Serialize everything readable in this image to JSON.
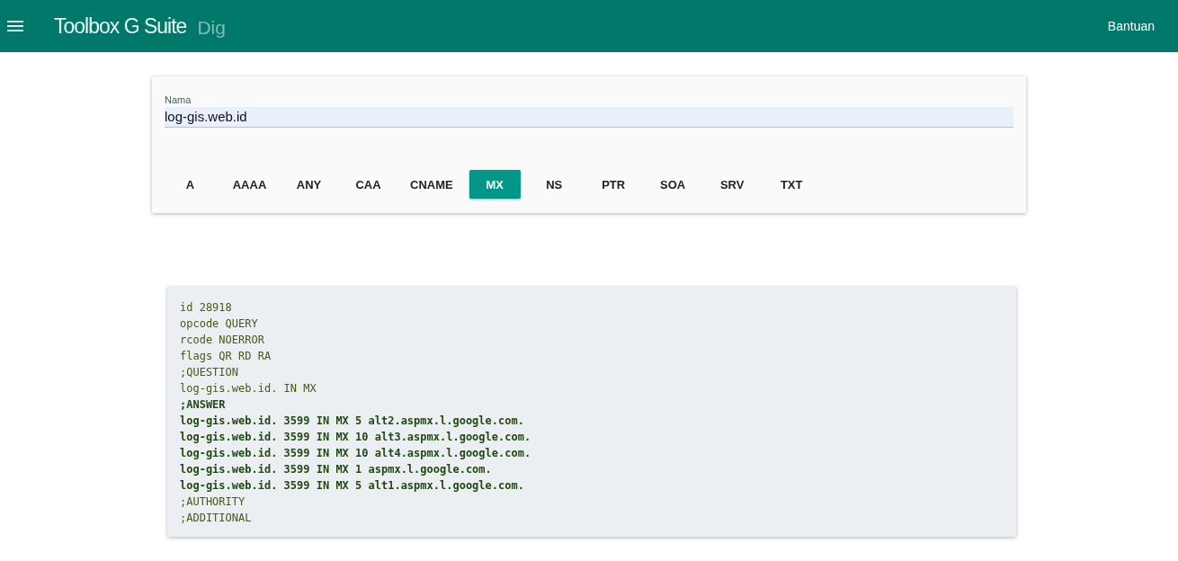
{
  "app_bar": {
    "title": "Toolbox G Suite",
    "subtitle": "Dig",
    "help_link": "Bantuan"
  },
  "form": {
    "name_label": "Nama",
    "name_value": "log-gis.web.id",
    "record_types": [
      {
        "label": "A",
        "selected": false
      },
      {
        "label": "AAAA",
        "selected": false
      },
      {
        "label": "ANY",
        "selected": false
      },
      {
        "label": "CAA",
        "selected": false
      },
      {
        "label": "CNAME",
        "selected": false
      },
      {
        "label": "MX",
        "selected": true
      },
      {
        "label": "NS",
        "selected": false
      },
      {
        "label": "PTR",
        "selected": false
      },
      {
        "label": "SOA",
        "selected": false
      },
      {
        "label": "SRV",
        "selected": false
      },
      {
        "label": "TXT",
        "selected": false
      }
    ]
  },
  "result": {
    "lines": [
      {
        "text": "id 28918",
        "bold": false
      },
      {
        "text": "opcode QUERY",
        "bold": false
      },
      {
        "text": "rcode NOERROR",
        "bold": false
      },
      {
        "text": "flags QR RD RA",
        "bold": false
      },
      {
        "text": ";QUESTION",
        "bold": false
      },
      {
        "text": "log-gis.web.id. IN MX",
        "bold": false
      },
      {
        "text": ";ANSWER",
        "bold": true
      },
      {
        "text": "log-gis.web.id. 3599 IN MX 5 alt2.aspmx.l.google.com.",
        "bold": true
      },
      {
        "text": "log-gis.web.id. 3599 IN MX 10 alt3.aspmx.l.google.com.",
        "bold": true
      },
      {
        "text": "log-gis.web.id. 3599 IN MX 10 alt4.aspmx.l.google.com.",
        "bold": true
      },
      {
        "text": "log-gis.web.id. 3599 IN MX 1 aspmx.l.google.com.",
        "bold": true
      },
      {
        "text": "log-gis.web.id. 3599 IN MX 5 alt1.aspmx.l.google.com.",
        "bold": true
      },
      {
        "text": ";AUTHORITY",
        "bold": false
      },
      {
        "text": ";ADDITIONAL",
        "bold": false
      }
    ]
  }
}
